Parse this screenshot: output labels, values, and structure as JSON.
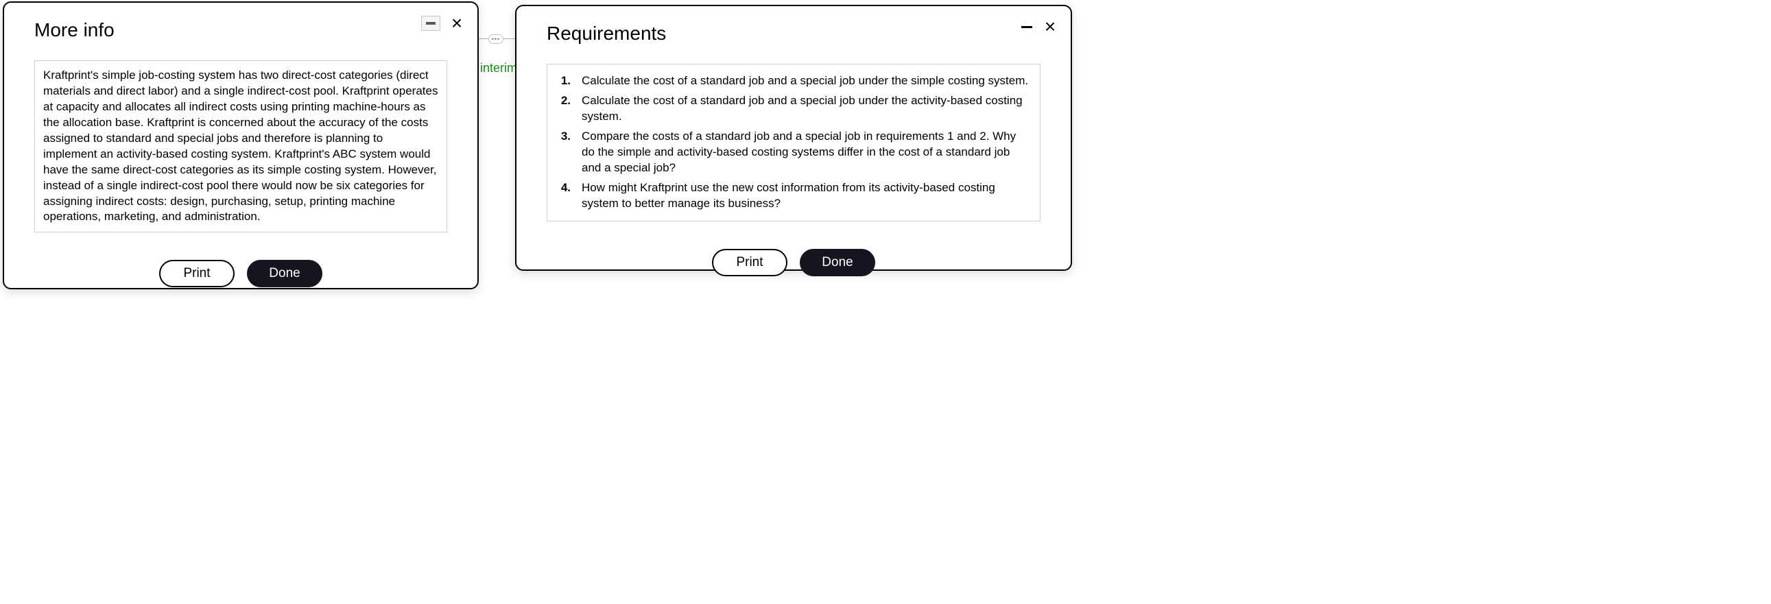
{
  "background": {
    "interim_text": "interim"
  },
  "left_dialog": {
    "title": "More info",
    "body": "Kraftprint's simple job-costing system has two direct-cost categories (direct materials and direct labor) and a single indirect-cost pool. Kraftprint operates at capacity and allocates all indirect costs using printing machine-hours as the allocation base. Kraftprint is concerned about the accuracy of the costs assigned to standard and special jobs and therefore is planning to implement an activity-based costing system. Kraftprint's ABC system would have the same direct-cost categories as its simple costing system. However, instead of a single indirect-cost pool there would now be six categories for assigning indirect costs: design, purchasing, setup, printing machine operations, marketing, and administration.",
    "print_label": "Print",
    "done_label": "Done"
  },
  "right_dialog": {
    "title": "Requirements",
    "items": [
      {
        "num": "1.",
        "text": "Calculate the cost of a standard job and a special job under the simple costing system."
      },
      {
        "num": "2.",
        "text": "Calculate the cost of a standard job and a special job under the activity-based costing system."
      },
      {
        "num": "3.",
        "text": "Compare the costs of a standard job and a special job in requirements 1 and 2. Why do the simple and activity-based costing systems differ in the cost of a standard job and a special job?"
      },
      {
        "num": "4.",
        "text": "How might Kraftprint use the new cost information from its activity-based costing system to better manage its business?"
      }
    ],
    "print_label": "Print",
    "done_label": "Done"
  },
  "connector": {
    "dots": "•••"
  }
}
